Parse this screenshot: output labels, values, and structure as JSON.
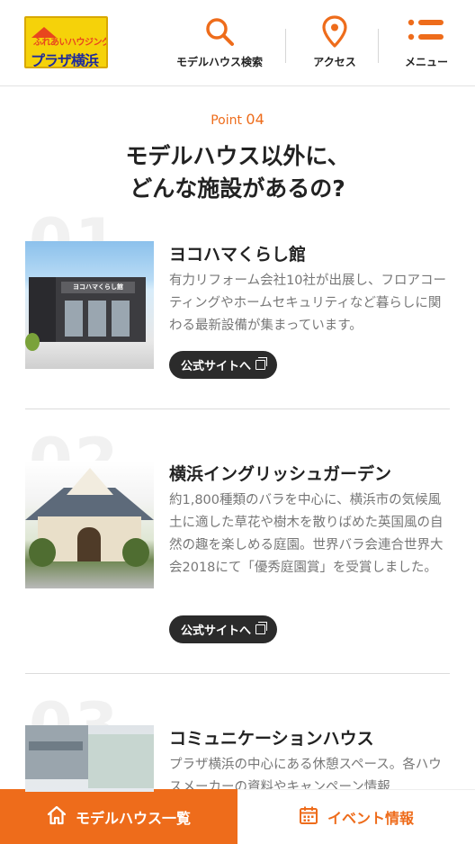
{
  "header": {
    "logo": {
      "top_text": "ふれあいハウジング",
      "bottom_text": "プラザ横浜"
    },
    "nav": [
      {
        "label": "モデルハウス検索",
        "icon": "search-icon"
      },
      {
        "label": "アクセス",
        "icon": "map-pin-icon"
      },
      {
        "label": "メニュー",
        "icon": "menu-icon"
      }
    ]
  },
  "section": {
    "point_prefix": "Point",
    "point_number": "04",
    "title_line1": "モデルハウス以外に、",
    "title_line2": "どんな施設があるの?"
  },
  "facilities": [
    {
      "number": "01",
      "photo_sign": "ヨコハマくらし館",
      "title": "ヨコハマくらし館",
      "description": "有力リフォーム会社10社が出展し、フロアコーティングやホームセキュリティなど暮らしに関わる最新設備が集まっています。",
      "button_label": "公式サイトへ"
    },
    {
      "number": "02",
      "title": "横浜イングリッシュガーデン",
      "description": "約1,800種類のバラを中心に、横浜市の気候風土に適した草花や樹木を散りばめた英国風の自然の趣を楽しめる庭園。世界バラ会連合世界大会2018にて「優秀庭園賞」を受賞しました。",
      "button_label": "公式サイトへ"
    },
    {
      "number": "03",
      "title": "コミュニケーションハウス",
      "description": "プラザ横浜の中心にある休憩スペース。各ハウスメーカーの資料やキャンペーン情報"
    }
  ],
  "bottom_bar": {
    "left_label": "モデルハウス一覧",
    "left_icon": "home-icon",
    "right_label": "イベント情報",
    "right_icon": "calendar-icon"
  },
  "colors": {
    "accent": "#ee6c1b",
    "dark_button": "#2b2b2b",
    "logo_yellow": "#f5d20a"
  }
}
